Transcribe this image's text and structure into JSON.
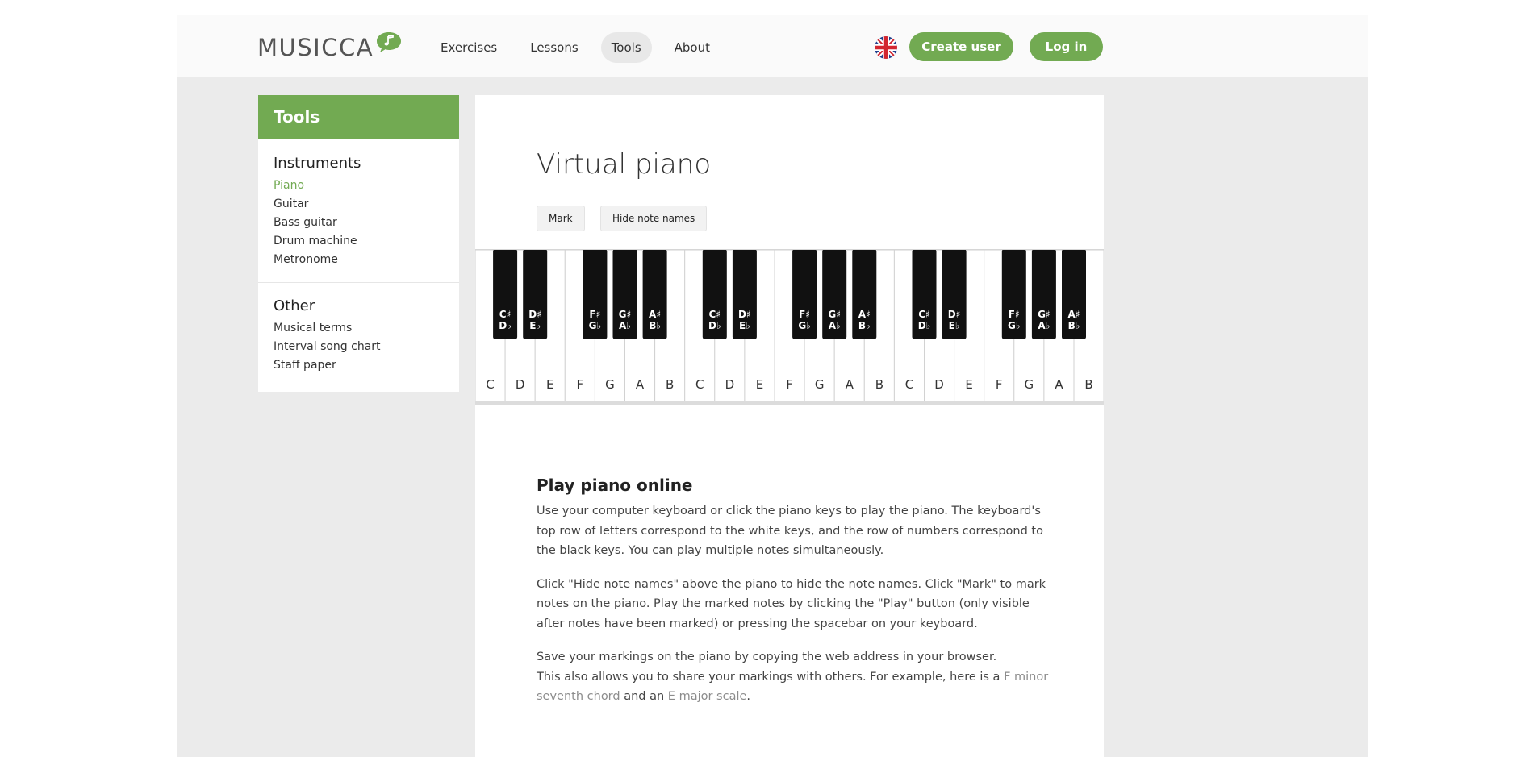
{
  "brand": {
    "logo_text": "MUSICCA"
  },
  "nav": {
    "items": [
      {
        "label": "Exercises",
        "active": false
      },
      {
        "label": "Lessons",
        "active": false
      },
      {
        "label": "Tools",
        "active": true
      },
      {
        "label": "About",
        "active": false
      }
    ],
    "flag_icon": "uk-flag-icon",
    "create_user": "Create user",
    "login": "Log in"
  },
  "sidebar": {
    "title": "Tools",
    "instruments": {
      "heading": "Instruments",
      "items": [
        "Piano",
        "Guitar",
        "Bass guitar",
        "Drum machine",
        "Metronome"
      ]
    },
    "other": {
      "heading": "Other",
      "items": [
        "Musical terms",
        "Interval song chart",
        "Staff paper"
      ]
    }
  },
  "main": {
    "title": "Virtual piano",
    "mark_button": "Mark",
    "hide_button": "Hide note names"
  },
  "piano": {
    "white_keys": [
      "C",
      "D",
      "E",
      "F",
      "G",
      "A",
      "B",
      "C",
      "D",
      "E",
      "F",
      "G",
      "A",
      "B",
      "C",
      "D",
      "E",
      "F",
      "G",
      "A",
      "B"
    ],
    "black_key_groups": [
      {
        "sharp": "C♯",
        "flat": "D♭"
      },
      {
        "sharp": "D♯",
        "flat": "E♭"
      },
      {
        "sharp": "F♯",
        "flat": "G♭"
      },
      {
        "sharp": "G♯",
        "flat": "A♭"
      },
      {
        "sharp": "A♯",
        "flat": "B♭"
      }
    ]
  },
  "article": {
    "heading": "Play piano online",
    "p1": "Use your computer keyboard or click the piano keys to play the piano. The keyboard's top row of letters correspond to the white keys, and the row of numbers correspond to the black keys. You can play multiple notes simultaneously.",
    "p2": "Click \"Hide note names\" above the piano to hide the note names. Click \"Mark\" to mark notes on the piano. Play the marked notes by clicking the \"Play\" button (only visible after notes have been marked) or pressing the spacebar on your keyboard.",
    "p3_line1": "Save your markings on the piano by copying the web address in your browser.",
    "p3_line2_prefix": "This also allows you to share your markings with others. For example, here is a ",
    "link_fminor": "F minor seventh chord",
    "p3_mid": " and an ",
    "link_emajor": "E major scale",
    "p3_suffix": "."
  },
  "colors": {
    "accent": "#72aa52",
    "link": "#8c8c8c",
    "background": "#ebebeb"
  }
}
